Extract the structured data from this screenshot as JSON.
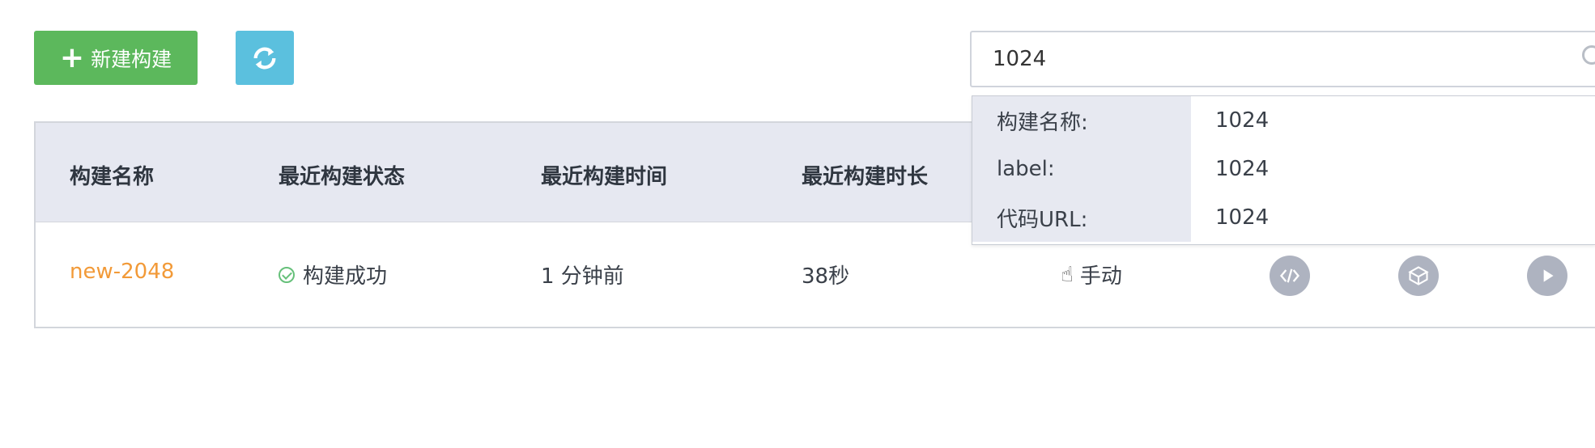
{
  "toolbar": {
    "new_build_label": "新建构建"
  },
  "search": {
    "value": "1024"
  },
  "table": {
    "headers": [
      "构建名称",
      "最近构建状态",
      "最近构建时间",
      "最近构建时长"
    ],
    "rows": [
      {
        "name": "new-2048",
        "status": "构建成功",
        "time": "1 分钟前",
        "duration": "38秒",
        "trigger": "手动"
      }
    ]
  },
  "suggestions": [
    {
      "key": "构建名称:",
      "value": "1024"
    },
    {
      "key": "label:",
      "value": "1024"
    },
    {
      "key": "代码URL:",
      "value": "1024"
    }
  ],
  "colors": {
    "primary_button": "#5cb85c",
    "refresh_button": "#5bc0de",
    "name_link": "#f29a38",
    "header_bg": "#e6e8f1",
    "success": "#66c07a"
  },
  "icons": {
    "refresh": "refresh-icon",
    "code": "code-icon",
    "package": "package-icon",
    "play": "play-icon",
    "hand": "hand-pointer-icon"
  }
}
